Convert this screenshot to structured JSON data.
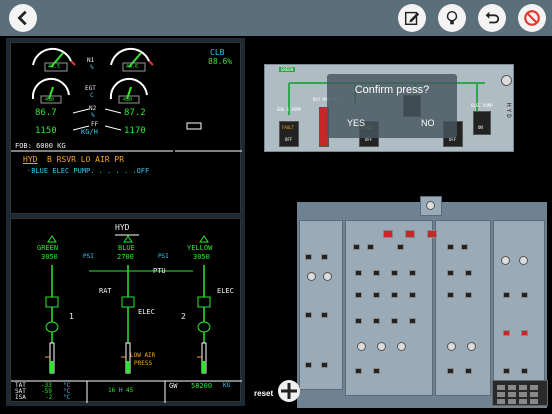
{
  "toolbar": {
    "back_icon": "back-arrow-icon",
    "edit_icon": "edit-icon",
    "hint_icon": "lightbulb-icon",
    "undo_icon": "undo-icon",
    "cancel_icon": "no-entry-icon",
    "cancel_color": "#e23b2e"
  },
  "ewd": {
    "mode": "CLB",
    "thrust": "88.6%",
    "n1_label": "N1",
    "n1_unit": "%",
    "n1_left": "44.5",
    "n1_right": "44.6",
    "egt_label": "EGT",
    "egt_unit": "C",
    "egt_left": "430",
    "egt_right": "430",
    "n2_label": "N2",
    "n2_unit": "%",
    "n2_left": "86.7",
    "n2_right": "87.2",
    "ff_label": "FF",
    "ff_unit": "KG/H",
    "ff_left": "1150",
    "ff_right": "1170",
    "fob": "FOB: 6000 KG",
    "warn_sys": "HYD",
    "warn_msg": "B RSVR LO AIR PR",
    "action": "-BLUE ELEC PUMP. . . . . .OFF"
  },
  "sd": {
    "title": "HYD",
    "green_label": "GREEN",
    "green_psi": "3050",
    "blue_label": "BLUE",
    "blue_psi": "2700",
    "yellow_label": "YELLOW",
    "yellow_psi": "3050",
    "psi_unit": "PSI",
    "rat": "RAT",
    "ptu": "PTU",
    "elec_right": "ELEC",
    "elec_blue": "ELEC",
    "pump1": "1",
    "pump2": "2",
    "low_air": "LOW AIR",
    "press": "PRESS",
    "tat_label": "TAT",
    "tat_val": "-33",
    "sat_label": "SAT",
    "sat_val": "-59",
    "isa_label": "ISA",
    "isa_val": "-2",
    "temp_unit": "°C",
    "time_h": "16",
    "time_m": "45",
    "time_sep": "H",
    "gw_label": "GW",
    "gw_val": "58200",
    "gw_unit": "KG"
  },
  "hyd_panel": {
    "green_tag": "GREEN",
    "eng1_pump": "ENG 1 PUMP",
    "fault": "FAULT",
    "off": "OFF",
    "rat_label": "RAT MAN ON",
    "elec_pump": "ELEC PUMP",
    "on": "ON",
    "side_label": "HYD"
  },
  "dialog": {
    "question": "Confirm press?",
    "yes": "YES",
    "no": "NO"
  },
  "reset_label": "reset"
}
